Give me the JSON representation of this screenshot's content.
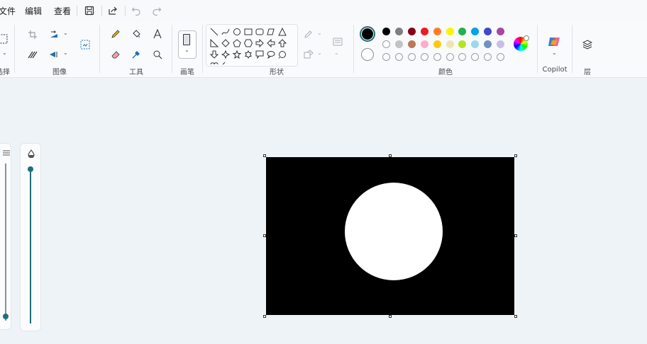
{
  "menu": {
    "file": "文件",
    "edit": "编辑",
    "view": "查看"
  },
  "groups": {
    "select": "选择",
    "image": "图像",
    "tools": "工具",
    "brush": "画笔",
    "shapes": "形状",
    "colors": "颜色",
    "copilot": "Copilot",
    "layers": "层"
  },
  "colors": {
    "primary": "#000000",
    "secondary": "#ffffff",
    "accent": "#1f6f7a",
    "palette_row1": [
      "#000000",
      "#7f7f7f",
      "#880015",
      "#ed1c24",
      "#ff7f27",
      "#fff200",
      "#22b14c",
      "#00a2e8",
      "#3f48cc",
      "#a349a4"
    ],
    "palette_row2": [
      "#ffffff",
      "#c3c3c3",
      "#b97a57",
      "#ffaec9",
      "#ffc90e",
      "#efe4b0",
      "#b5e61d",
      "#99d9ea",
      "#7092be",
      "#c8bfe7"
    ]
  },
  "canvas": {
    "background": "#000000",
    "shape_fill": "#ffffff"
  }
}
